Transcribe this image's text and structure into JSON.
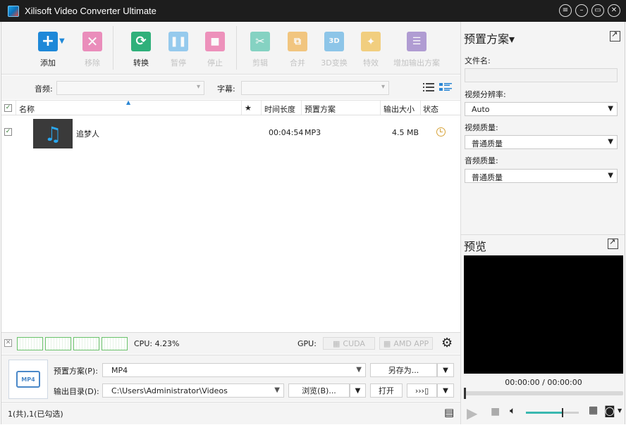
{
  "window": {
    "title": "Xilisoft Video Converter Ultimate"
  },
  "toolbar": {
    "add": "添加",
    "remove": "移除",
    "convert": "转换",
    "pause": "暂停",
    "stop": "停止",
    "clip": "剪辑",
    "merge": "合并",
    "threed": "3D变换",
    "effects": "特效",
    "add_output": "增加输出方案",
    "threed_badge": "3D"
  },
  "filters": {
    "audio_label": "音频:",
    "subtitle_label": "字幕:"
  },
  "grid": {
    "headers": {
      "name": "名称",
      "star": "★",
      "duration": "时间长度",
      "preset": "预置方案",
      "size": "输出大小",
      "status": "状态"
    },
    "rows": [
      {
        "name": "追梦人",
        "duration": "00:04:54",
        "preset": "MP3",
        "size": "4.5 MB",
        "checked": true
      }
    ]
  },
  "cpu": {
    "label": "CPU: 4.23%",
    "gpu_label": "GPU:",
    "cuda": "CUDA",
    "amd": "AMD APP"
  },
  "bottom": {
    "preset_label": "预置方案(P):",
    "preset_value": "MP4",
    "save_as": "另存为...",
    "output_label": "输出目录(D):",
    "output_value": "C:\\Users\\Administrator\\Videos",
    "browse": "浏览(B)...",
    "open": "打开",
    "mp4_badge": "MP4"
  },
  "status": {
    "count": "1(共),1(已勾选)"
  },
  "right_panel": {
    "title": "预置方案▾",
    "filename_label": "文件名:",
    "resolution_label": "视频分辨率:",
    "resolution_value": "Auto",
    "video_quality_label": "视频质量:",
    "video_quality_value": "普通质量",
    "audio_quality_label": "音频质量:",
    "audio_quality_value": "普通质量",
    "preview_title": "预览",
    "time": "00:00:00 / 00:00:00"
  },
  "colors": {
    "add": "#1e88d8",
    "remove": "#e23a8d",
    "convert": "#2fb07a",
    "pause": "#4aa8e8",
    "stop": "#e8428e",
    "clip": "#2cb89a",
    "merge": "#f0a020",
    "threed": "#3aa0e0",
    "effects": "#f0b020",
    "add_output": "#7a55b8"
  }
}
